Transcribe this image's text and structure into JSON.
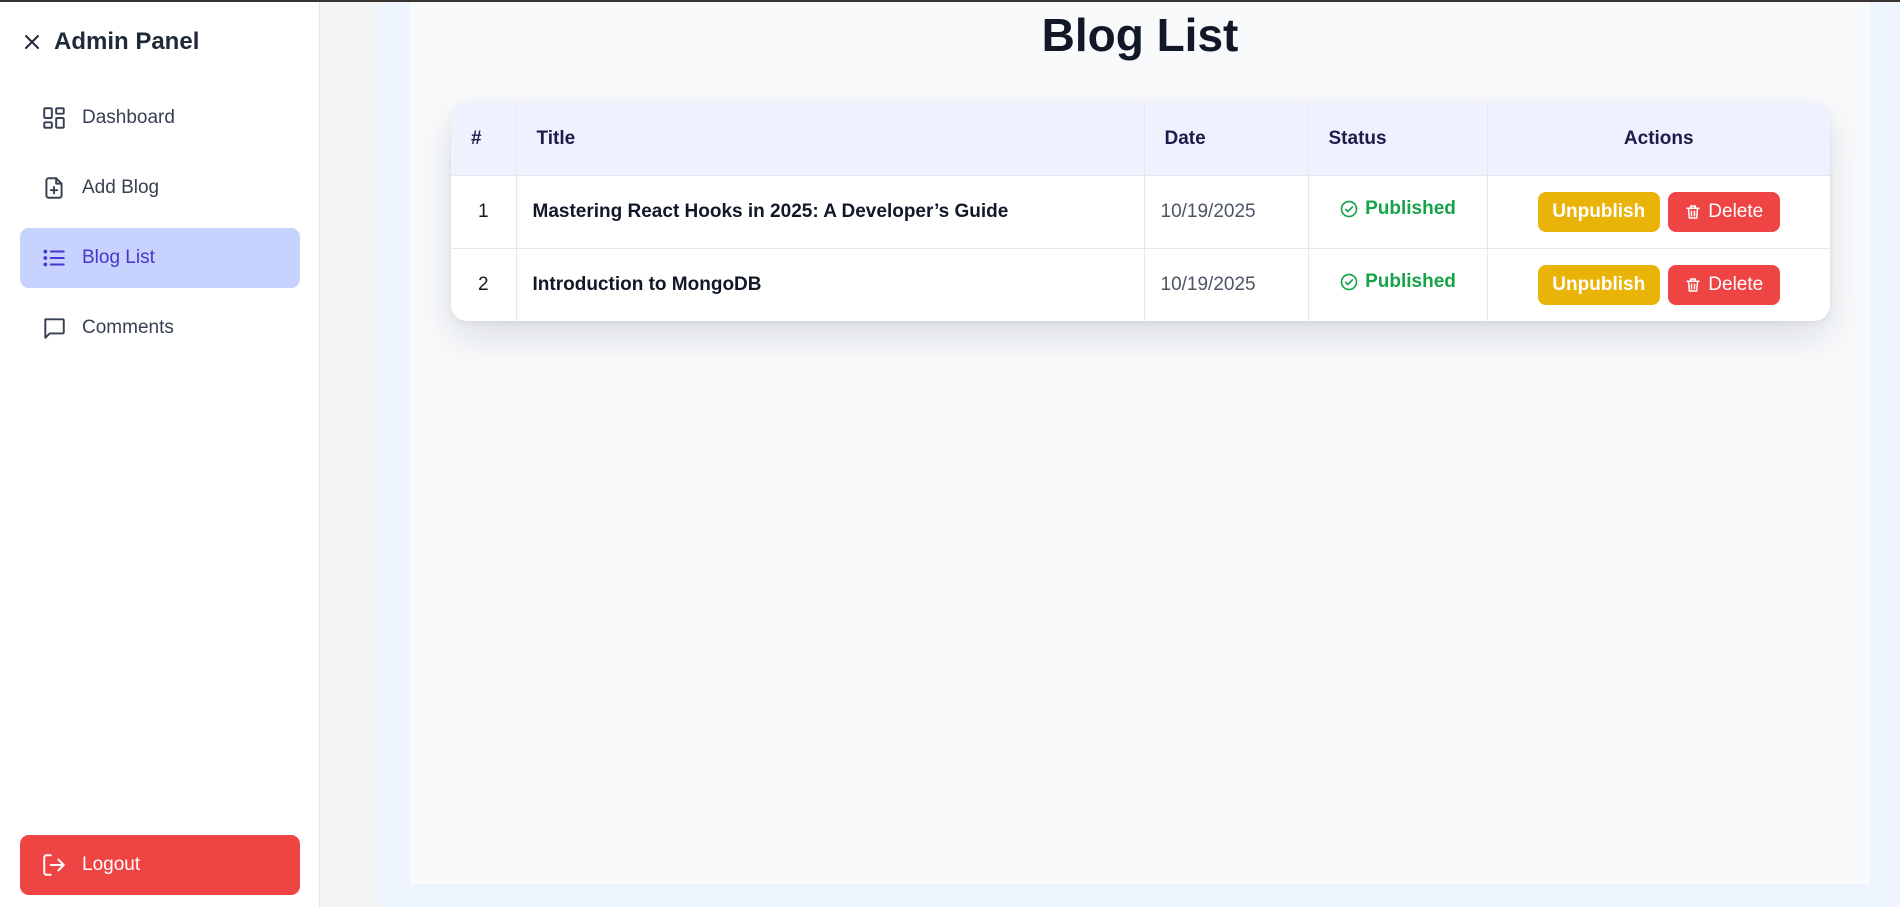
{
  "sidebar": {
    "title": "Admin Panel",
    "items": [
      {
        "label": "Dashboard",
        "icon": "dashboard-icon"
      },
      {
        "label": "Add Blog",
        "icon": "file-plus-icon"
      },
      {
        "label": "Blog List",
        "icon": "list-icon",
        "active": true
      },
      {
        "label": "Comments",
        "icon": "message-square-icon"
      }
    ],
    "logout_label": "Logout"
  },
  "main": {
    "page_title": "Blog List",
    "table": {
      "headers": [
        "#",
        "Title",
        "Date",
        "Status",
        "Actions"
      ],
      "rows": [
        {
          "num": "1",
          "title": "Mastering React Hooks in 2025: A Developer’s Guide",
          "date": "10/19/2025",
          "status": "Published",
          "unpublish": "Unpublish",
          "delete": "Delete"
        },
        {
          "num": "2",
          "title": "Introduction to MongoDB",
          "date": "10/19/2025",
          "status": "Published",
          "unpublish": "Unpublish",
          "delete": "Delete"
        }
      ]
    }
  },
  "colors": {
    "accent_active_bg": "#c7d2fe",
    "accent_active_text": "#4338ca",
    "logout_bg": "#ef4444",
    "unpublish_bg": "#eab308",
    "delete_bg": "#ef4444",
    "published_text": "#16a34a"
  }
}
